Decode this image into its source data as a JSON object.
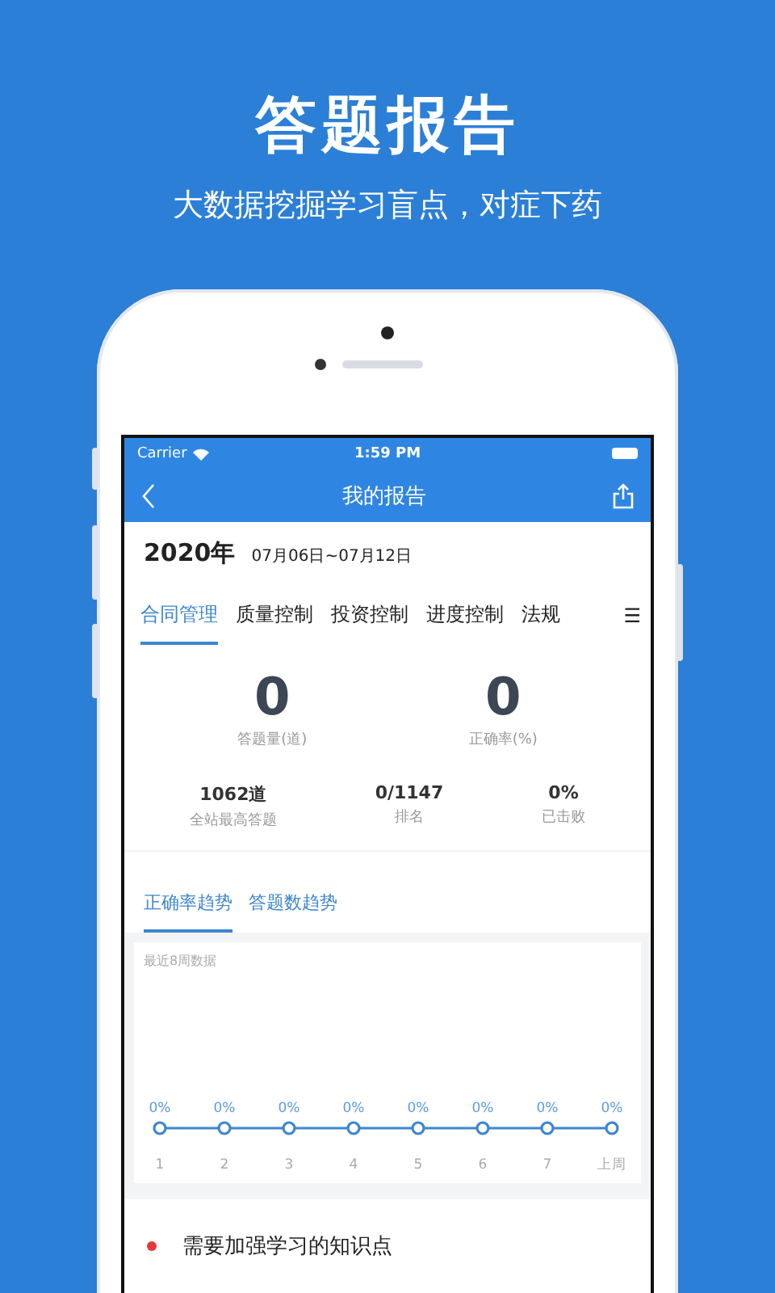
{
  "headline": "答题报告",
  "subtitle": "大数据挖掘学习盲点，对症下药",
  "status_bar": {
    "carrier": "Carrier",
    "time": "1:59 PM"
  },
  "nav": {
    "title": "我的报告"
  },
  "period": {
    "year": "2020年",
    "range": "07月06日~07月12日"
  },
  "tabs": [
    {
      "label": "合同管理",
      "selected": true
    },
    {
      "label": "质量控制",
      "selected": false
    },
    {
      "label": "投资控制",
      "selected": false
    },
    {
      "label": "进度控制",
      "selected": false
    },
    {
      "label": "法规",
      "selected": false
    }
  ],
  "tabs_menu": "☰",
  "main_stats": [
    {
      "value": "0",
      "label": "答题量(道)"
    },
    {
      "value": "0",
      "label": "正确率(%)"
    }
  ],
  "sub_stats": [
    {
      "value": "1062道",
      "label": "全站最高答题"
    },
    {
      "value": "0/1147",
      "label": "排名"
    },
    {
      "value": "0%",
      "label": "已击败"
    }
  ],
  "trend_tabs": [
    {
      "label": "正确率趋势",
      "selected": true
    },
    {
      "label": "答题数趋势",
      "selected": false
    }
  ],
  "trend_card": {
    "caption": "最近8周数据",
    "points": [
      {
        "value_label": "0%",
        "category": "1"
      },
      {
        "value_label": "0%",
        "category": "2"
      },
      {
        "value_label": "0%",
        "category": "3"
      },
      {
        "value_label": "0%",
        "category": "4"
      },
      {
        "value_label": "0%",
        "category": "5"
      },
      {
        "value_label": "0%",
        "category": "6"
      },
      {
        "value_label": "0%",
        "category": "7"
      },
      {
        "value_label": "0%",
        "category": "上周"
      }
    ]
  },
  "section": {
    "title": "需要加强学习的知识点",
    "color": "#e03a3a"
  }
}
